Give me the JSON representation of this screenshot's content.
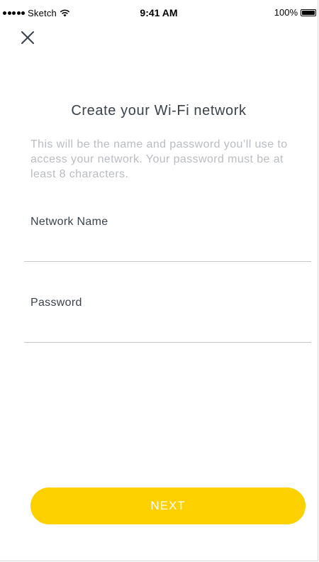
{
  "status_bar": {
    "carrier": "Sketch",
    "time": "9:41 AM",
    "battery": "100%"
  },
  "header": {
    "close_icon": "close-icon"
  },
  "main": {
    "title": "Create your Wi-Fi network",
    "description": "This will be the name and password you’ll use to access your network. Your password must be at least 8 characters.",
    "network_name": {
      "label": "Network Name",
      "value": ""
    },
    "password": {
      "label": "Password",
      "value": ""
    },
    "next_label": "NEXT"
  },
  "colors": {
    "accent": "#fdd000",
    "title": "#3a4249",
    "muted": "#b9bcc0",
    "divider": "#c4c7ca"
  }
}
